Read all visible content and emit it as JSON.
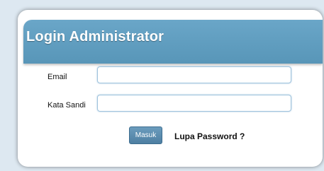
{
  "login": {
    "title": "Login Administrator",
    "email_label": "Email",
    "email_value": "",
    "password_label": "Kata Sandi",
    "password_value": "",
    "submit_label": "Masuk",
    "forgot_link": "Lupa Password ?"
  },
  "colors": {
    "header": "#5b9abc",
    "button": "#5a8bae",
    "background": "#dde8f1"
  }
}
